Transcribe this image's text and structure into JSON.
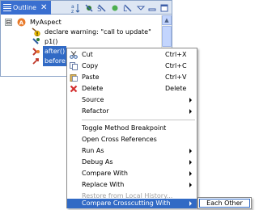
{
  "outline": {
    "tab_title": "Outline",
    "close_glyph": "✕",
    "toolbar_icons": [
      "sort-icon",
      "hide-fields-icon",
      "hide-static-icon",
      "hide-non-public-icon",
      "hide-local-types-icon",
      "minimize-icon",
      "maximize-icon",
      "view-menu-icon"
    ],
    "tree": [
      {
        "label": "MyAspect",
        "icon": "aspect-icon",
        "expander": "⊟"
      },
      {
        "label": "declare warning: \"call to update\"",
        "icon": "declare-warning-icon"
      },
      {
        "label": "p1()",
        "icon": "pointcut-icon"
      },
      {
        "label": "after()",
        "icon": "advice-after-icon",
        "selected": true
      },
      {
        "label": "before",
        "icon": "advice-before-icon",
        "selected": true
      }
    ]
  },
  "context_menu": {
    "items": [
      {
        "label": "Cut",
        "accel": "Ctrl+X",
        "icon": "cut-icon"
      },
      {
        "label": "Copy",
        "accel": "Ctrl+C",
        "icon": "copy-icon"
      },
      {
        "label": "Paste",
        "accel": "Ctrl+V",
        "icon": "paste-icon"
      },
      {
        "label": "Delete",
        "accel": "Delete",
        "icon": "delete-icon"
      },
      {
        "label": "Source",
        "submenu": true
      },
      {
        "label": "Refactor",
        "submenu": true
      },
      {
        "label": "Toggle Method Breakpoint"
      },
      {
        "label": "Open Cross References"
      },
      {
        "label": "Run As",
        "submenu": true
      },
      {
        "label": "Debug As",
        "submenu": true
      },
      {
        "label": "Compare With",
        "submenu": true
      },
      {
        "label": "Replace With",
        "submenu": true
      },
      {
        "label": "Restore from Local History...",
        "disabled": true
      },
      {
        "label": "Compare Crosscutting With",
        "submenu": true,
        "highlighted": true
      }
    ]
  },
  "submenu": {
    "items": [
      {
        "label": "Each Other"
      }
    ]
  },
  "colors": {
    "selection": "#316ac5",
    "tab_active": "#3a6fd0",
    "disabled_text": "#a0a0a0"
  }
}
